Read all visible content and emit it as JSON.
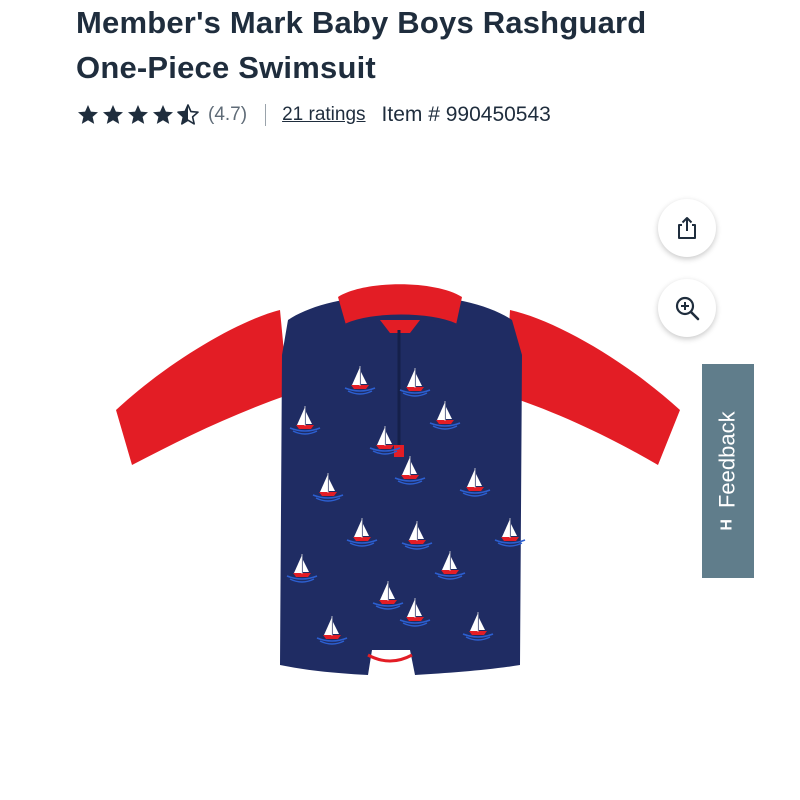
{
  "product": {
    "title_line1": "Member's Mark Baby Boys Rashguard",
    "title_line2": "One-Piece Swimsuit",
    "rating": 4.7,
    "rating_label": "(4.7)",
    "ratings_link": "21 ratings",
    "item_number": "Item # 990450543"
  },
  "buttons": {
    "share_icon": "share-icon",
    "zoom_icon": "zoom-in-icon"
  },
  "feedback": {
    "label": "Feedback",
    "icon_glyph": "H"
  },
  "colors": {
    "title": "#1f2d3d",
    "star": "#1f2d3d",
    "feedback_bg": "#607d8b",
    "swimsuit_navy": "#1f2c63",
    "swimsuit_red": "#e31d25"
  }
}
